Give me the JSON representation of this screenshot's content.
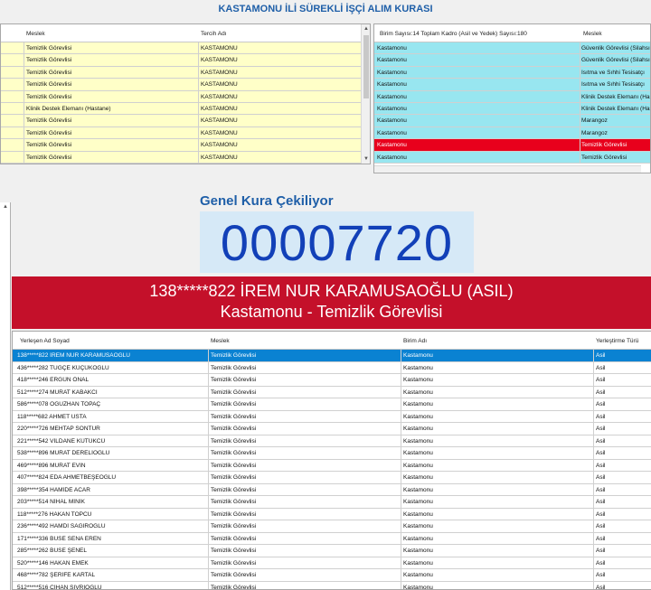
{
  "title": "KASTAMONU İLİ SÜREKLİ İŞÇİ ALIM KURASI",
  "left_grid": {
    "headers": [
      "Meslek",
      "Tercih Adı"
    ],
    "rows": [
      [
        "Temizlik Görevlisi",
        "KASTAMONU"
      ],
      [
        "Temizlik Görevlisi",
        "KASTAMONU"
      ],
      [
        "Temizlik Görevlisi",
        "KASTAMONU"
      ],
      [
        "Temizlik Görevlisi",
        "KASTAMONU"
      ],
      [
        "Temizlik Görevlisi",
        "KASTAMONU"
      ],
      [
        "Klinik Destek Elemanı (Hastane)",
        "KASTAMONU"
      ],
      [
        "Temizlik Görevlisi",
        "KASTAMONU"
      ],
      [
        "Temizlik Görevlisi",
        "KASTAMONU"
      ],
      [
        "Temizlik Görevlisi",
        "KASTAMONU"
      ],
      [
        "Temizlik Görevlisi",
        "KASTAMONU"
      ]
    ]
  },
  "right_grid": {
    "headers": [
      "Birim Sayısı:14 Toplam Kadro (Asil ve Yedek) Sayısı:180",
      "Meslek"
    ],
    "selected_index": 8,
    "rows": [
      [
        "Kastamonu",
        "Güvenlik Görevlisi (Silahsız)"
      ],
      [
        "Kastamonu",
        "Güvenlik Görevlisi (Silahsız)"
      ],
      [
        "Kastamonu",
        "Isıtma ve Sıhhi Tesisatçı"
      ],
      [
        "Kastamonu",
        "Isıtma ve Sıhhi Tesisatçı"
      ],
      [
        "Kastamonu",
        "Klinik Destek Elemanı (Hastane)"
      ],
      [
        "Kastamonu",
        "Klinik Destek Elemanı (Hastane)"
      ],
      [
        "Kastamonu",
        "Marangoz"
      ],
      [
        "Kastamonu",
        "Marangoz"
      ],
      [
        "Kastamonu",
        "Temizlik Görevlisi"
      ],
      [
        "Kastamonu",
        "Temizlik Görevlisi"
      ]
    ]
  },
  "draw": {
    "label": "Genel Kura Çekiliyor",
    "number": "00007720",
    "winner_line1": "138*****822 İREM NUR KARAMUSAOĞLU (ASIL)",
    "winner_line2": "Kastamonu - Temizlik Görevlisi"
  },
  "bottom_grid": {
    "headers": [
      "Yerleşen Ad Soyad",
      "Meslek",
      "Birim Adı",
      "Yerleştirme Türü"
    ],
    "selected_index": 0,
    "rows": [
      [
        "138*****822 İREM NUR KARAMUSAOĞLU",
        "Temizlik Görevlisi",
        "Kastamonu",
        "Asil"
      ],
      [
        "436*****282 TUĞÇE KÜÇÜKOĞLU",
        "Temizlik Görevlisi",
        "Kastamonu",
        "Asil"
      ],
      [
        "418*****246 ERGÜN ÖNAL",
        "Temizlik Görevlisi",
        "Kastamonu",
        "Asil"
      ],
      [
        "512*****274 MURAT KABAKCI",
        "Temizlik Görevlisi",
        "Kastamonu",
        "Asil"
      ],
      [
        "586*****078 OĞUZHAN TOPAÇ",
        "Temizlik Görevlisi",
        "Kastamonu",
        "Asil"
      ],
      [
        "118*****682 AHMET USTA",
        "Temizlik Görevlisi",
        "Kastamonu",
        "Asil"
      ],
      [
        "220*****726 MEHTAP SONTUR",
        "Temizlik Görevlisi",
        "Kastamonu",
        "Asil"
      ],
      [
        "221*****542 VİLDANE KÜTÜKCÜ",
        "Temizlik Görevlisi",
        "Kastamonu",
        "Asil"
      ],
      [
        "538*****896 MURAT DERELİOĞLU",
        "Temizlik Görevlisi",
        "Kastamonu",
        "Asil"
      ],
      [
        "469*****896 MURAT EVİN",
        "Temizlik Görevlisi",
        "Kastamonu",
        "Asil"
      ],
      [
        "407*****824 EDA AHMETBEŞEOĞLU",
        "Temizlik Görevlisi",
        "Kastamonu",
        "Asil"
      ],
      [
        "398*****354 HAMİDE ACAR",
        "Temizlik Görevlisi",
        "Kastamonu",
        "Asil"
      ],
      [
        "203*****514 NİHAL MİNİK",
        "Temizlik Görevlisi",
        "Kastamonu",
        "Asil"
      ],
      [
        "118*****276 HAKAN TOPCU",
        "Temizlik Görevlisi",
        "Kastamonu",
        "Asil"
      ],
      [
        "236*****492 HAMDİ SAĞIROĞLU",
        "Temizlik Görevlisi",
        "Kastamonu",
        "Asil"
      ],
      [
        "171*****336 BUSE SENA EREN",
        "Temizlik Görevlisi",
        "Kastamonu",
        "Asil"
      ],
      [
        "285*****262 BUSE ŞENEL",
        "Temizlik Görevlisi",
        "Kastamonu",
        "Asil"
      ],
      [
        "520*****146 HAKAN EMEK",
        "Temizlik Görevlisi",
        "Kastamonu",
        "Asil"
      ],
      [
        "468*****782 ŞERİFE KARTAL",
        "Temizlik Görevlisi",
        "Kastamonu",
        "Asil"
      ],
      [
        "512*****516 CİHAN SIVRIOĞLU",
        "Temizlik Görevlisi",
        "Kastamonu",
        "Asil"
      ]
    ]
  },
  "colors": {
    "title_blue": "#1f5fa8",
    "left_row_bg": "#ffffc8",
    "right_row_bg": "#98e6f0",
    "selected_red": "#e8001c",
    "banner_red": "#c4102a",
    "counter_bg": "#d6e9f7",
    "counter_text": "#1240b8",
    "selected_blue": "#0a82d2"
  }
}
